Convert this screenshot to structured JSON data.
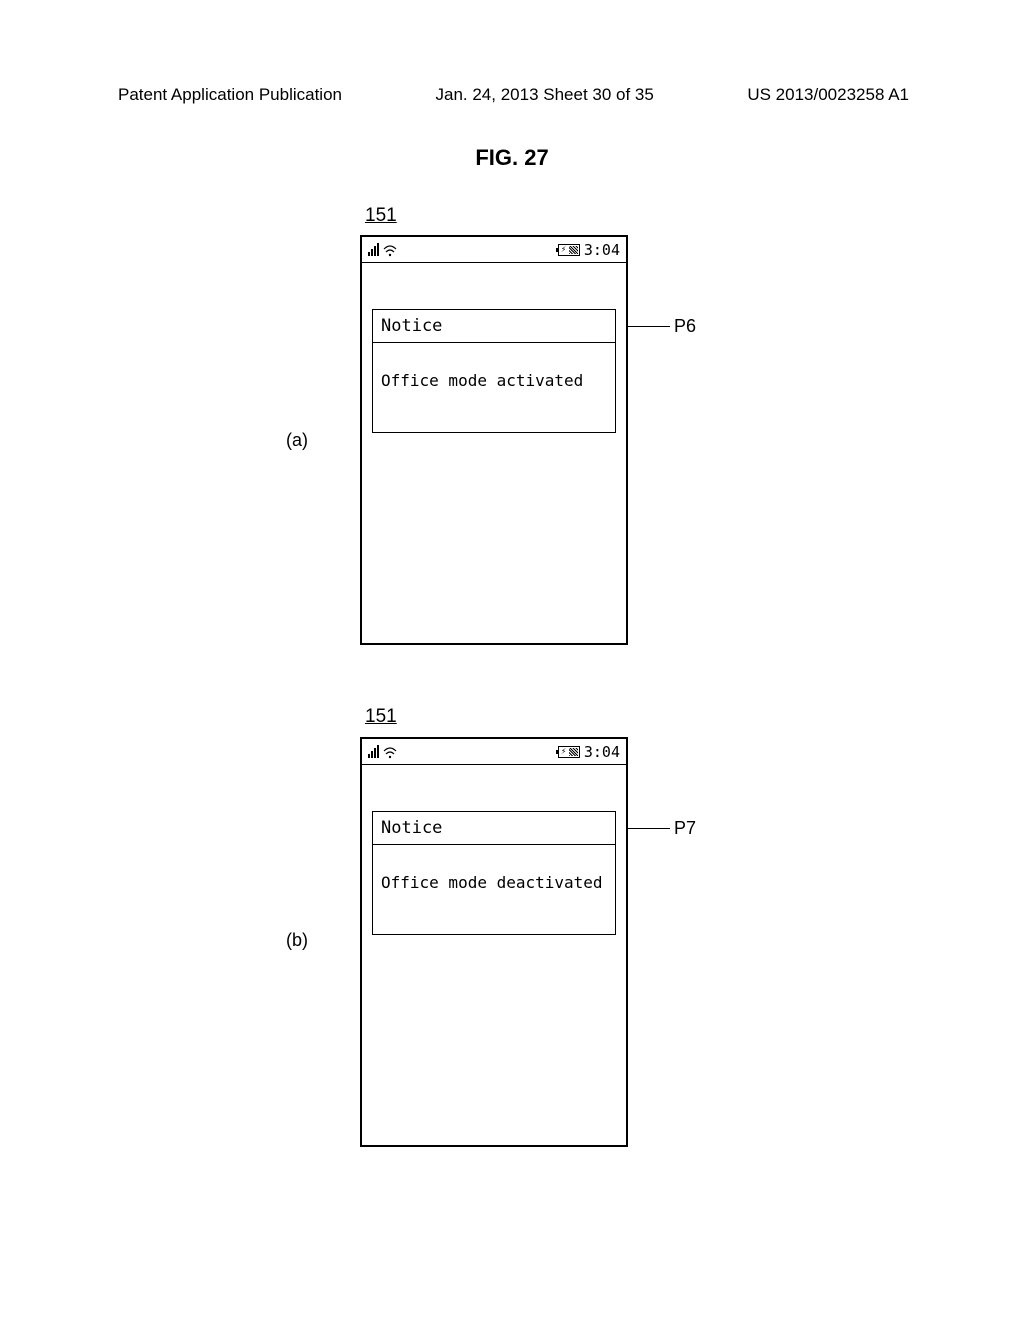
{
  "header": {
    "left": "Patent Application Publication",
    "center": "Jan. 24, 2013  Sheet 30 of 35",
    "right": "US 2013/0023258 A1"
  },
  "figure_title": "FIG. 27",
  "reference_151": "151",
  "status_time": "3:04",
  "subfigure_a": {
    "label": "(a)",
    "notice_title": "Notice",
    "notice_body": "Office mode activated",
    "callout": "P6"
  },
  "subfigure_b": {
    "label": "(b)",
    "notice_title": "Notice",
    "notice_body": "Office mode deactivated",
    "callout": "P7"
  }
}
